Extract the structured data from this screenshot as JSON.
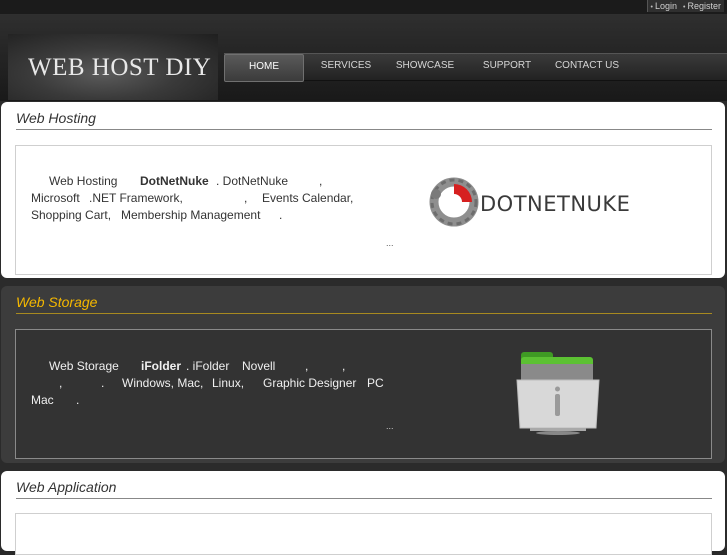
{
  "top_links": [
    "Login",
    "Register"
  ],
  "logo_text": "WEB HOST DIY",
  "nav": [
    "HOME",
    "SERVICES",
    "SHOWCASE",
    "SUPPORT",
    "CONTACT US"
  ],
  "hosting": {
    "title": "Web Hosting",
    "line1": [
      "Web Hosting",
      "DotNetNuke",
      ". DotNetNuke",
      ","
    ],
    "line2": [
      "Microsoft",
      ".NET Framework,",
      ",",
      "Events Calendar,"
    ],
    "line3": [
      "Shopping Cart,",
      "Membership Management",
      "."
    ],
    "ellipsis": "...",
    "logo_text": "DOTNETNUKE"
  },
  "storage": {
    "title": "Web Storage",
    "line1": [
      "Web Storage",
      "iFolder",
      ". iFolder",
      "Novell",
      ",",
      ","
    ],
    "line2": [
      ",",
      ".",
      "Windows, Mac,",
      "Linux,",
      "Graphic Designer",
      "PC"
    ],
    "line3": [
      "Mac",
      "."
    ],
    "ellipsis": "..."
  },
  "application": {
    "title": "Web Application"
  },
  "colors": {
    "accent": "#f5b800",
    "dark_panel": "#3c3c3c"
  }
}
